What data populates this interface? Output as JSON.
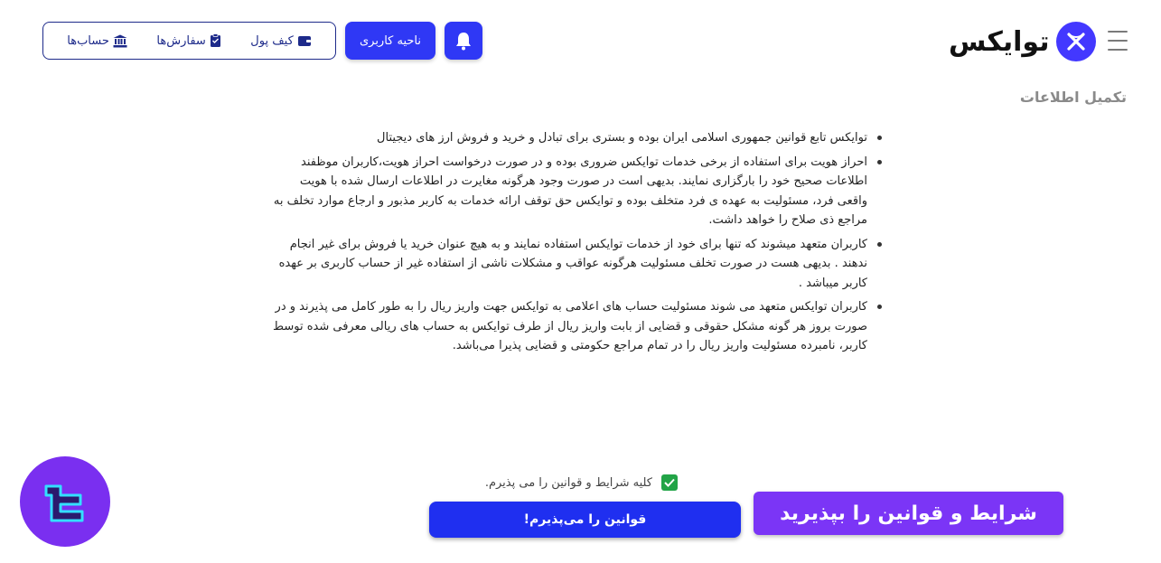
{
  "header": {
    "logo_text": "توایکس",
    "user_area_label": "ناحیه کاربری",
    "nav": [
      {
        "label": "کیف پول",
        "icon": "wallet-icon"
      },
      {
        "label": "سفارش‌ها",
        "icon": "clipboard-icon"
      },
      {
        "label": "حساب‌ها",
        "icon": "bank-icon"
      }
    ]
  },
  "main": {
    "title": "تکمیل اطلاعات",
    "terms": [
      "توایکس تابع قوانین جمهوری اسلامی ایران بوده و بستری برای تبادل و خرید و فروش ارز های دیجیتال",
      "احراز هویت برای استفاده از برخی خدمات توایکس ضروری بوده و در صورت درخواست احراز هویت،کاربران موظفند اطلاعات صحیح خود را بارگزاری نمایند. بدیهی است در صورت وجود هرگونه مغایرت در اطلاعات ارسال شده با هویت واقعی فرد، مسئولیت به عهده ی فرد متخلف بوده و توایکس حق توقف ارائه خدمات به کاربر مذبور و ارجاع موارد تخلف به مراجع ذی صلاح را خواهد داشت.",
      "کاربران متعهد میشوند که تنها برای خود از خدمات توایکس استفاده نمایند و به هیچ عنوان خرید یا فروش برای غیر انجام ندهند . بدیهی هست در صورت تخلف مسئولیت هرگونه عواقب و مشکلات ناشی از استفاده غیر از حساب کاربری بر عهده کاربر میباشد .",
      "کاربران توایکس متعهد می شوند مسئولیت حساب های اعلامی به توایکس جهت واریز ریال را به طور کامل می پذیرند و در صورت بروز هر گونه مشکل حقوقی و قضایی از بابت واریز ریال از طرف توایکس به حساب های ریالی معرفی شده توسط کاربر، نامبرده مسئولیت واریز ریال را در تمام مراجع حکومتی و قضایی پذیرا می‌باشد."
    ]
  },
  "footer": {
    "agree_label": "کلیه شرایط و قوانین را می پذیرم.",
    "agree_checked": true,
    "accept_button": "قوانین را می‌پذیرم!",
    "banner_text": "شرایط و قوانین را بپذیرید"
  },
  "colors": {
    "primary": "#2f38f5",
    "banner": "#7b35f6",
    "check": "#22a447"
  }
}
